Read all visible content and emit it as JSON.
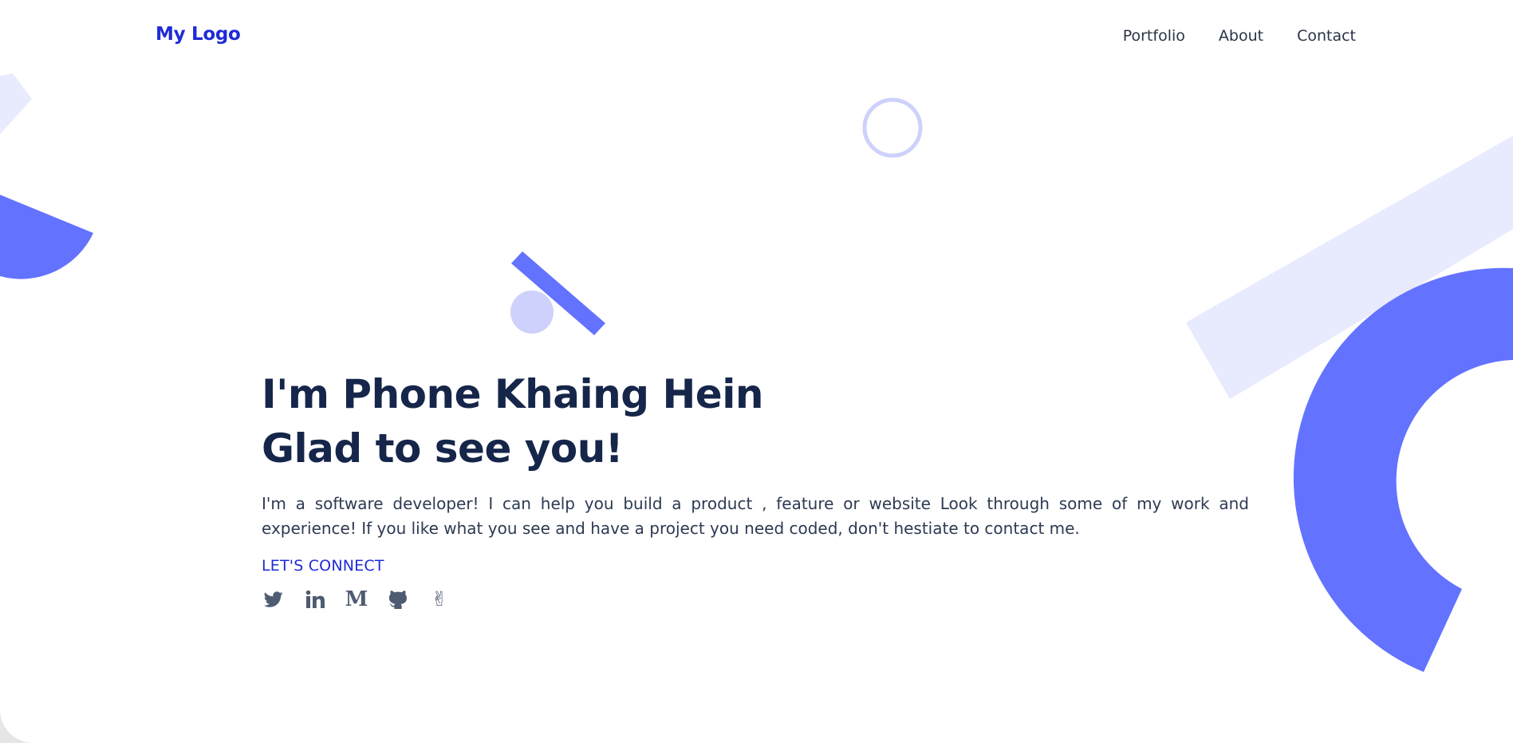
{
  "header": {
    "logo": "My Logo",
    "nav": [
      "Portfolio",
      "About",
      "Contact"
    ]
  },
  "hero": {
    "line1": "I'm Phone Khaing Hein",
    "line2": "Glad to see you!",
    "intro": "I'm a software developer! I can help you build a product , feature or website Look through some of my work and experience! If you like what you see and have a project you need coded, don't hestiate to contact me.",
    "connect_label": "LET'S CONNECT"
  },
  "socials": [
    {
      "icon": "twitter-icon"
    },
    {
      "icon": "linkedin-icon",
      "glyph": "in"
    },
    {
      "icon": "medium-icon",
      "glyph": "M"
    },
    {
      "icon": "github-icon"
    },
    {
      "icon": "angellist-icon",
      "glyph": "✌"
    }
  ],
  "colors": {
    "accent": "#1f2bd6",
    "heading": "#16264a",
    "shape_primary": "#6372ff",
    "shape_light": "#e8eafd",
    "shape_mid": "#cdd1fb"
  }
}
